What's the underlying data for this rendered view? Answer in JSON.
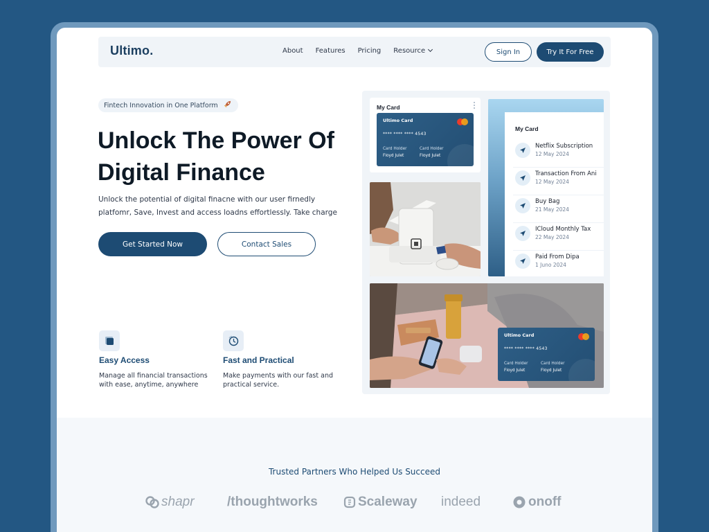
{
  "nav": {
    "logo": "Ultimo.",
    "links": [
      "About",
      "Features",
      "Pricing",
      "Resource"
    ],
    "signin": "Sign In",
    "try": "Try It For Free"
  },
  "hero": {
    "badge": "Fintech Innovation in One Platform",
    "badge_icon": "rocket-icon",
    "title_line1": "Unlock The Power Of",
    "title_line2": "Digital Finance",
    "subtitle": "Unlock the potential of digital finacne with our user firnedly platfomr, Save, Invest and access loadns effortlessly. Take charge",
    "cta_primary": "Get Started Now",
    "cta_secondary": "Contact Sales"
  },
  "features": [
    {
      "title": "Easy Access",
      "desc": "Manage all financial transactions with ease, anytime, anywhere",
      "icon": "layers-icon"
    },
    {
      "title": "Fast and Practical",
      "desc": "Make payments with our fast and practical service.",
      "icon": "clock-icon"
    }
  ],
  "card_widget": {
    "title": "My Card",
    "card": {
      "name": "Ultimo Card",
      "number": "**** **** **** 4543",
      "holder1_label": "Card Holder",
      "holder1_name": "Floyd Julet",
      "holder2_label": "Card Holder",
      "holder2_name": "Floyd Julet"
    }
  },
  "transactions": {
    "title": "My Card",
    "items": [
      {
        "name": "Netflix Subscription",
        "date": "12 May 2024"
      },
      {
        "name": "Transaction From Ani",
        "date": "12 May 2024"
      },
      {
        "name": "Buy Bag",
        "date": "21 May 2024"
      },
      {
        "name": "ICloud Monthly Tax",
        "date": "22 May 2024"
      },
      {
        "name": "Paid From Dipa",
        "date": "1 Juno 2024"
      }
    ]
  },
  "overlay_card": {
    "name": "Ultimo Card",
    "number": "**** **** **** 4543",
    "holder1_label": "Card Holder",
    "holder1_name": "Floyd Julet",
    "holder2_label": "Card Holder",
    "holder2_name": "Floyd Julet"
  },
  "partners": {
    "title": "Trusted Partners Who Helped Us Succeed",
    "logos": [
      "shapr",
      "/thoughtworks",
      "Scaleway",
      "indeed",
      "onoff"
    ]
  },
  "colors": {
    "background": "#235783",
    "primary": "#1d4b73",
    "text": "#0e1a26"
  }
}
